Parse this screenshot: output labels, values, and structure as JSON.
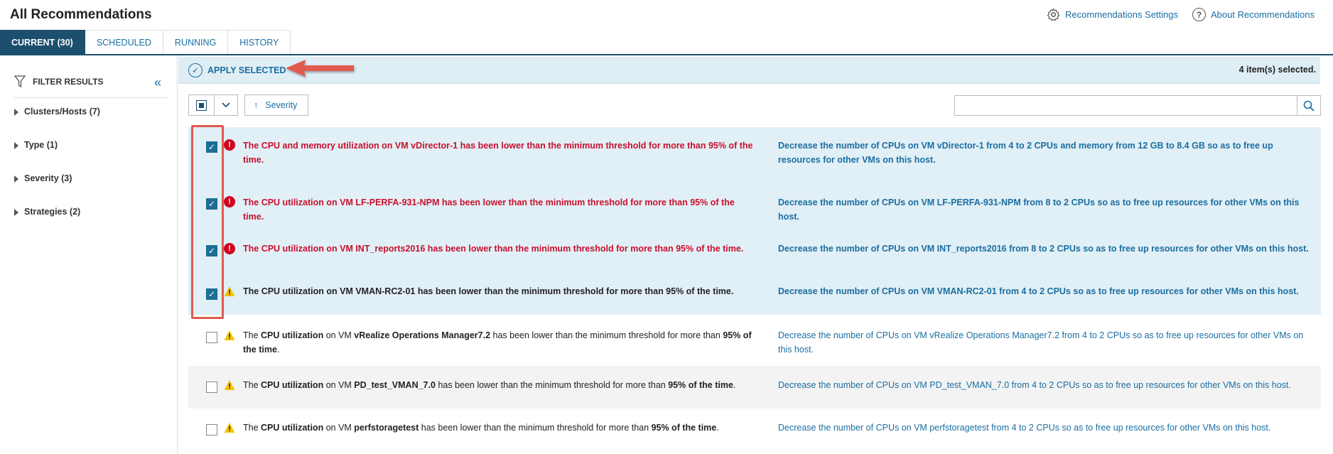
{
  "header": {
    "title": "All Recommendations",
    "settings_label": "Recommendations Settings",
    "about_label": "About Recommendations"
  },
  "tabs": [
    {
      "label": "CURRENT (30)",
      "active": true
    },
    {
      "label": "SCHEDULED"
    },
    {
      "label": "RUNNING"
    },
    {
      "label": "HISTORY"
    }
  ],
  "sidebar": {
    "title": "FILTER RESULTS",
    "collapse_icon": "double-chevron-left-icon",
    "filters": [
      {
        "label": "Clusters/Hosts (7)"
      },
      {
        "label": "Type (1)"
      },
      {
        "label": "Severity (3)"
      },
      {
        "label": "Strategies (2)"
      }
    ]
  },
  "actionbar": {
    "apply_label": "APPLY SELECTED",
    "selected_count": "4 item(s) selected."
  },
  "toolbar": {
    "sort_label": "Severity",
    "search_placeholder": ""
  },
  "colors": {
    "accent": "#1c4e6d",
    "link": "#1a6ea1",
    "error": "#c8102e",
    "warning": "#f5c400",
    "selected_row": "#e1eff6"
  }
}
